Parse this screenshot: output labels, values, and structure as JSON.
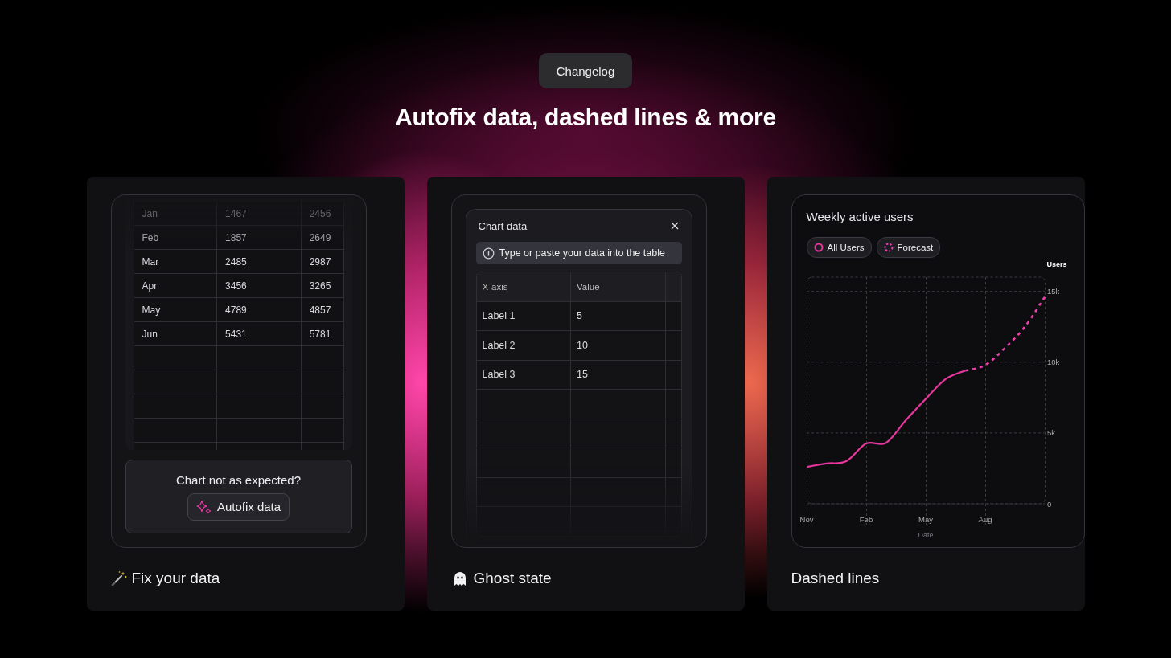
{
  "badge": "Changelog",
  "title": "Autofix data, dashed lines & more",
  "cards": [
    {
      "kind": "table_fix",
      "caption": "Fix your data",
      "table": {
        "rows": [
          [
            "Jan",
            "1467",
            "2456"
          ],
          [
            "Feb",
            "1857",
            "2649"
          ],
          [
            "Mar",
            "2485",
            "2987"
          ],
          [
            "Apr",
            "3456",
            "3265"
          ],
          [
            "May",
            "4789",
            "4857"
          ],
          [
            "Jun",
            "5431",
            "5781"
          ]
        ]
      },
      "prompt": "Chart not as expected?",
      "button": "Autofix data"
    },
    {
      "kind": "dialog",
      "caption": "Ghost state",
      "dialog": {
        "title": "Chart data",
        "info": "Type or paste your data into the table",
        "columns": [
          "X-axis",
          "Value"
        ],
        "rows": [
          [
            "Label 1",
            "5"
          ],
          [
            "Label 2",
            "10"
          ],
          [
            "Label 3",
            "15"
          ]
        ]
      }
    },
    {
      "kind": "chart",
      "caption": "Dashed lines",
      "chart_title": "Weekly active users",
      "chart_data": {
        "type": "line",
        "xlabel": "Date",
        "ylabel": "Users",
        "categories": [
          "Nov",
          null,
          null,
          "Feb",
          null,
          null,
          "May",
          null,
          null,
          "Aug",
          null,
          null,
          null
        ],
        "ylim": [
          0,
          16000
        ],
        "grid": true,
        "yticks": [
          {
            "value": 0,
            "label": "0"
          },
          {
            "value": 5000,
            "label": "5k"
          },
          {
            "value": 10000,
            "label": "10k"
          },
          {
            "value": 15000,
            "label": "15k"
          }
        ],
        "series": [
          {
            "name": "All Users",
            "color": "#e8369c",
            "line_style": "solid",
            "values": [
              2600,
              2850,
              3000,
              4250,
              4300,
              5900,
              7400,
              8800,
              9400,
              null,
              null,
              null,
              null
            ]
          },
          {
            "name": "Forecast",
            "color": "#f03cae",
            "line_style": "dashed",
            "values": [
              null,
              null,
              null,
              null,
              null,
              null,
              null,
              null,
              9400,
              9800,
              11000,
              12500,
              14600
            ]
          }
        ]
      }
    }
  ]
}
